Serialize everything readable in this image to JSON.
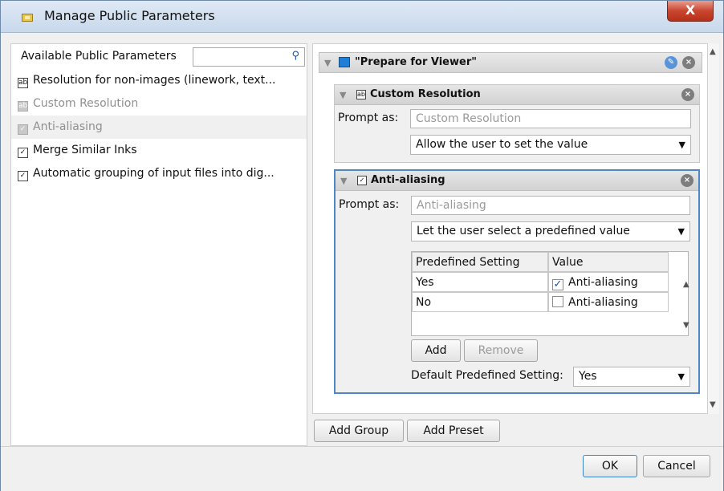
{
  "window": {
    "title": "Manage Public Parameters",
    "close_label": "X"
  },
  "left": {
    "header": "Available Public Parameters",
    "search_placeholder": "",
    "items": [
      {
        "label": "Resolution for non-images (linework, text...",
        "icon": "ab",
        "state": "normal"
      },
      {
        "label": "Custom Resolution",
        "icon": "ab",
        "state": "disabled"
      },
      {
        "label": "Anti-aliasing",
        "icon": "✓",
        "state": "disabled-selected"
      },
      {
        "label": "Merge Similar Inks",
        "icon": "✓",
        "state": "normal"
      },
      {
        "label": "Automatic grouping of input files into dig...",
        "icon": "✓",
        "state": "normal"
      }
    ]
  },
  "right": {
    "group_title": "\"Prepare for Viewer\"",
    "params": [
      {
        "title": "Custom Resolution",
        "prompt_label": "Prompt as:",
        "prompt_value": "Custom Resolution",
        "mode": "Allow the user to set the value"
      },
      {
        "title": "Anti-aliasing",
        "prompt_label": "Prompt as:",
        "prompt_value": "Anti-aliasing",
        "mode": "Let the user select a predefined value",
        "table": {
          "headers": [
            "Predefined Setting",
            "Value"
          ],
          "rows": [
            {
              "setting": "Yes",
              "checked": true,
              "value": "Anti-aliasing"
            },
            {
              "setting": "No",
              "checked": false,
              "value": "Anti-aliasing"
            }
          ]
        },
        "add_label": "Add",
        "remove_label": "Remove",
        "default_label": "Default Predefined Setting:",
        "default_value": "Yes"
      }
    ],
    "add_group_label": "Add Group",
    "add_preset_label": "Add Preset"
  },
  "footer": {
    "ok_label": "OK",
    "cancel_label": "Cancel"
  }
}
